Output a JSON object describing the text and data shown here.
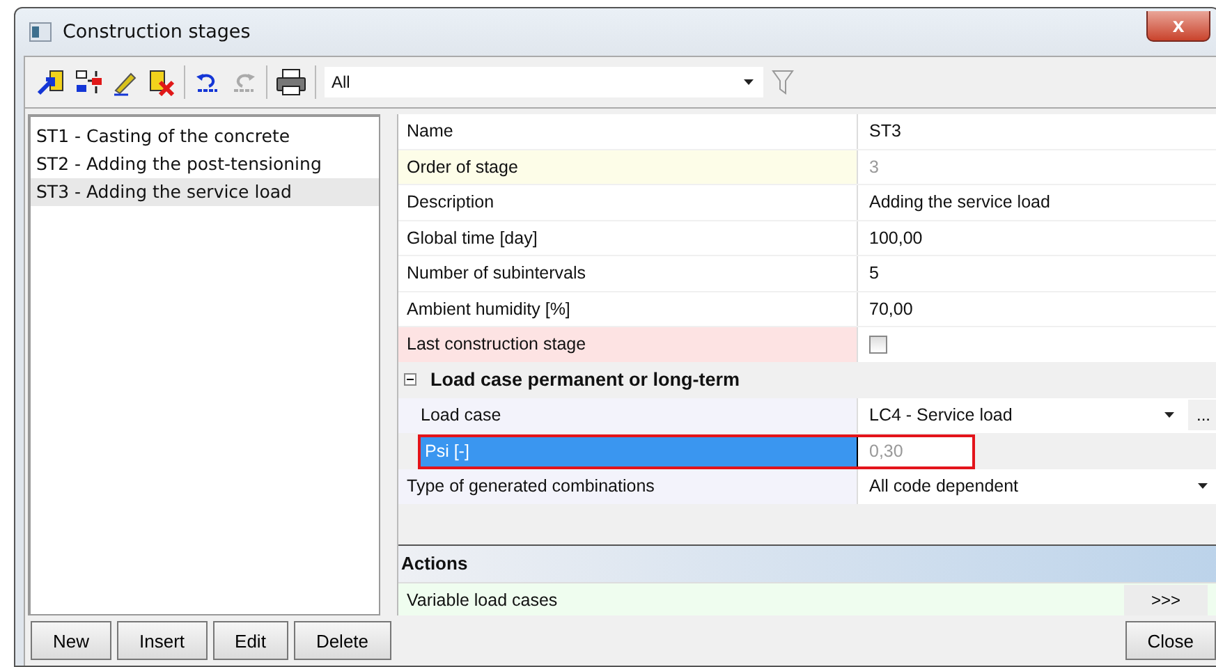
{
  "window": {
    "title": "Construction stages",
    "close": "x"
  },
  "toolbar": {
    "filter": "All"
  },
  "stages": [
    {
      "label": "ST1 - Casting of the concrete",
      "selected": false
    },
    {
      "label": "ST2 - Adding the post-tensioning",
      "selected": false
    },
    {
      "label": "ST3 - Adding the service load",
      "selected": true
    }
  ],
  "properties": [
    {
      "kind": "text",
      "name": "Name",
      "value": "ST3"
    },
    {
      "kind": "readonly",
      "name": "Order of stage",
      "value": "3"
    },
    {
      "kind": "text",
      "name": "Description",
      "value": "Adding the service load"
    },
    {
      "kind": "text",
      "name": "Global time [day]",
      "value": "100,00"
    },
    {
      "kind": "text",
      "name": "Number of subintervals",
      "value": "5"
    },
    {
      "kind": "text",
      "name": "Ambient humidity [%]",
      "value": "70,00"
    },
    {
      "kind": "checkbox",
      "name": "Last construction stage",
      "checked": false
    },
    {
      "kind": "group",
      "name": "Load case permanent or long-term",
      "expanded": true,
      "children": [
        {
          "kind": "dropdown",
          "name": "Load case",
          "value": "LC4 - Service load",
          "more": "..."
        },
        {
          "kind": "selected",
          "name": "Psi [-]",
          "value": "0,30",
          "highlighted": true
        }
      ]
    },
    {
      "kind": "dropdown",
      "name": "Type of generated combinations",
      "value": "All code dependent"
    }
  ],
  "actions": {
    "title": "Actions",
    "items": [
      {
        "label": "Variable load cases",
        "button": ">>>"
      }
    ]
  },
  "buttons_left": [
    "New",
    "Insert",
    "Edit",
    "Delete"
  ],
  "buttons_right": [
    "Close"
  ]
}
